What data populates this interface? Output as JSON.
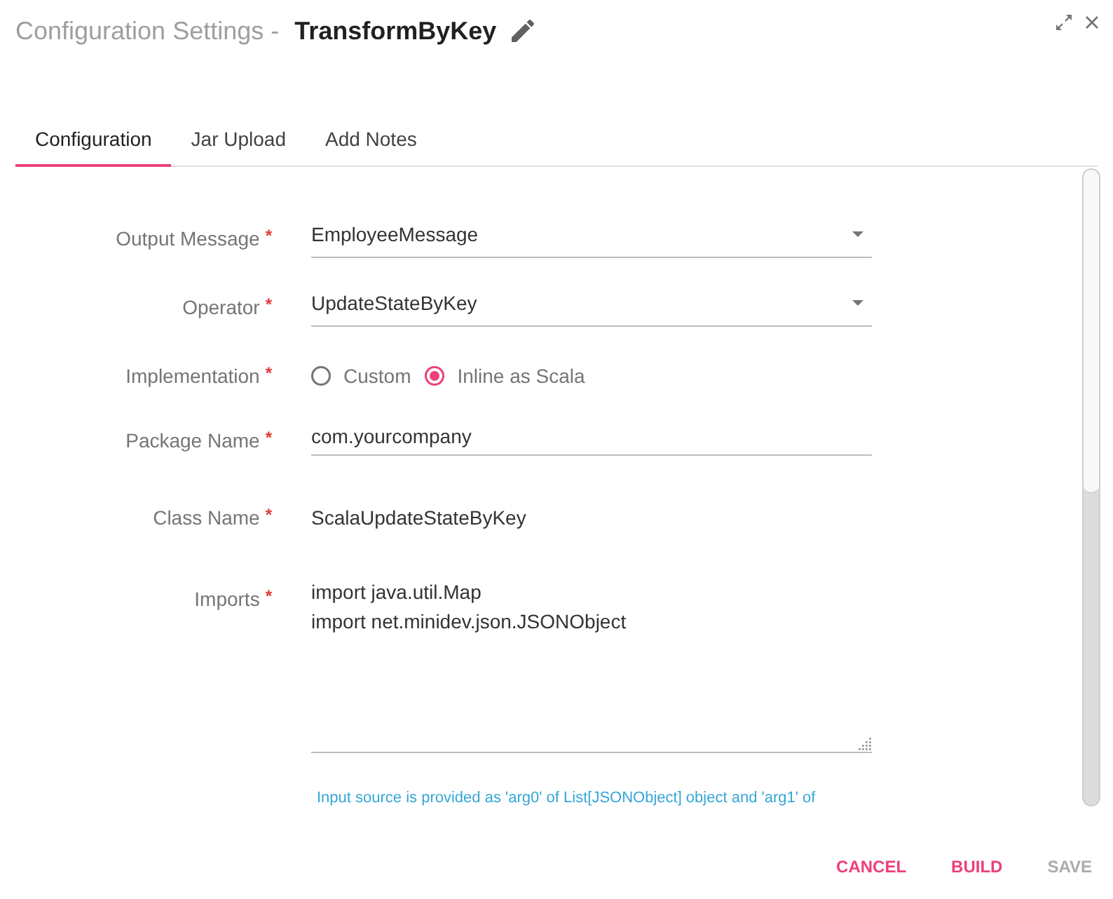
{
  "dialog": {
    "title_prefix": "Configuration Settings -",
    "title": "TransformByKey"
  },
  "tabs": [
    {
      "label": "Configuration",
      "selected": true
    },
    {
      "label": "Jar Upload",
      "selected": false
    },
    {
      "label": "Add Notes",
      "selected": false
    }
  ],
  "form": {
    "fields": [
      {
        "kind": "select",
        "label": "Output Message",
        "required_mark": "*",
        "value": "EmployeeMessage"
      },
      {
        "kind": "select",
        "label": "Operator",
        "required_mark": "*",
        "value": "UpdateStateByKey"
      },
      {
        "kind": "radio",
        "label": "Implementation",
        "required_mark": "*",
        "options": [
          {
            "label": "Custom",
            "selected": false
          },
          {
            "label": "Inline as Scala",
            "selected": true
          }
        ]
      },
      {
        "kind": "text",
        "label": "Package Name",
        "required_mark": "*",
        "value": "com.yourcompany"
      },
      {
        "kind": "static",
        "label": "Class Name",
        "required_mark": "*",
        "value": "ScalaUpdateStateByKey"
      },
      {
        "kind": "textarea",
        "label": "Imports",
        "required_mark": "*",
        "value": "import java.util.Map\nimport net.minidev.json.JSONObject"
      }
    ],
    "hint": "Input source is provided as 'arg0' of List[JSONObject] object and 'arg1' of"
  },
  "buttons": [
    {
      "label": "CANCEL",
      "disabled": false
    },
    {
      "label": "BUILD",
      "disabled": false
    },
    {
      "label": "SAVE",
      "disabled": true
    }
  ]
}
